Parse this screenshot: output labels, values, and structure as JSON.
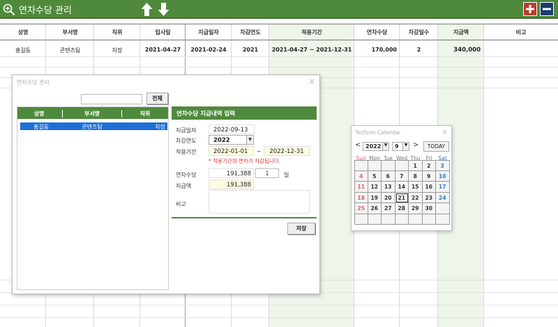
{
  "app": {
    "title": "연차수당 관리"
  },
  "colors": {
    "brand_green": "#4f8a3c",
    "selected_row": "#1e6fd6",
    "plus_button": "#c0392b",
    "minus_button": "#1f3b73",
    "sunday": "#e06060",
    "saturday": "#2a7ad6"
  },
  "grid": {
    "headers": [
      "성명",
      "부서명",
      "직위",
      "입사일",
      "지급일자",
      "차감연도",
      "적용기간",
      "연차수당",
      "차감일수",
      "지급액",
      "비고"
    ],
    "rows": [
      [
        "홍길동",
        "콘텐츠팀",
        "차장",
        "2021-04-27",
        "2021-02-24",
        "2021",
        "2021-04-27 ~ 2021-12-31",
        "170,000",
        "2",
        "340,000",
        ""
      ]
    ]
  },
  "dialog": {
    "title": "연차수당 관리",
    "search_button": "전체",
    "list_headers": [
      "성명",
      "부서명",
      "직위"
    ],
    "list_rows": [
      [
        "홍길동",
        "콘텐츠팀",
        "차장"
      ]
    ],
    "panel_title": "연차수당 지급내역 입력",
    "labels": {
      "pay_date": "지급일자",
      "deduct_year": "차감연도",
      "period": "적용기간",
      "allowance": "연차수당",
      "amount": "지급액",
      "memo": "비고",
      "day_unit": "일",
      "tilde": "~"
    },
    "values": {
      "pay_date": "2022-09-13",
      "deduct_year": "2022",
      "period_from": "2022-01-01",
      "period_to": "2022-12-31",
      "allowance": "191,388",
      "days": "1",
      "amount": "191,388",
      "memo": ""
    },
    "note": "* 적용기간의 연차가 차감됩니다.",
    "save_button": "저장"
  },
  "calendar": {
    "title": "Yesform Calendar",
    "prev": "<",
    "next": ">",
    "year": "2022",
    "month": "9",
    "today_button": "TODAY",
    "weekdays": [
      "Sun",
      "Mon",
      "Tue",
      "Wed",
      "Thu",
      "Fri",
      "Sat"
    ],
    "weeks": [
      [
        "",
        "",
        "",
        "",
        "1",
        "2",
        "3"
      ],
      [
        "4",
        "5",
        "6",
        "7",
        "8",
        "9",
        "10"
      ],
      [
        "11",
        "12",
        "13",
        "14",
        "15",
        "16",
        "17"
      ],
      [
        "18",
        "19",
        "20",
        "21",
        "22",
        "23",
        "24"
      ],
      [
        "25",
        "26",
        "27",
        "28",
        "29",
        "30",
        ""
      ],
      [
        "",
        "",
        "",
        "",
        "",
        "",
        ""
      ]
    ],
    "selected_day": "21"
  }
}
